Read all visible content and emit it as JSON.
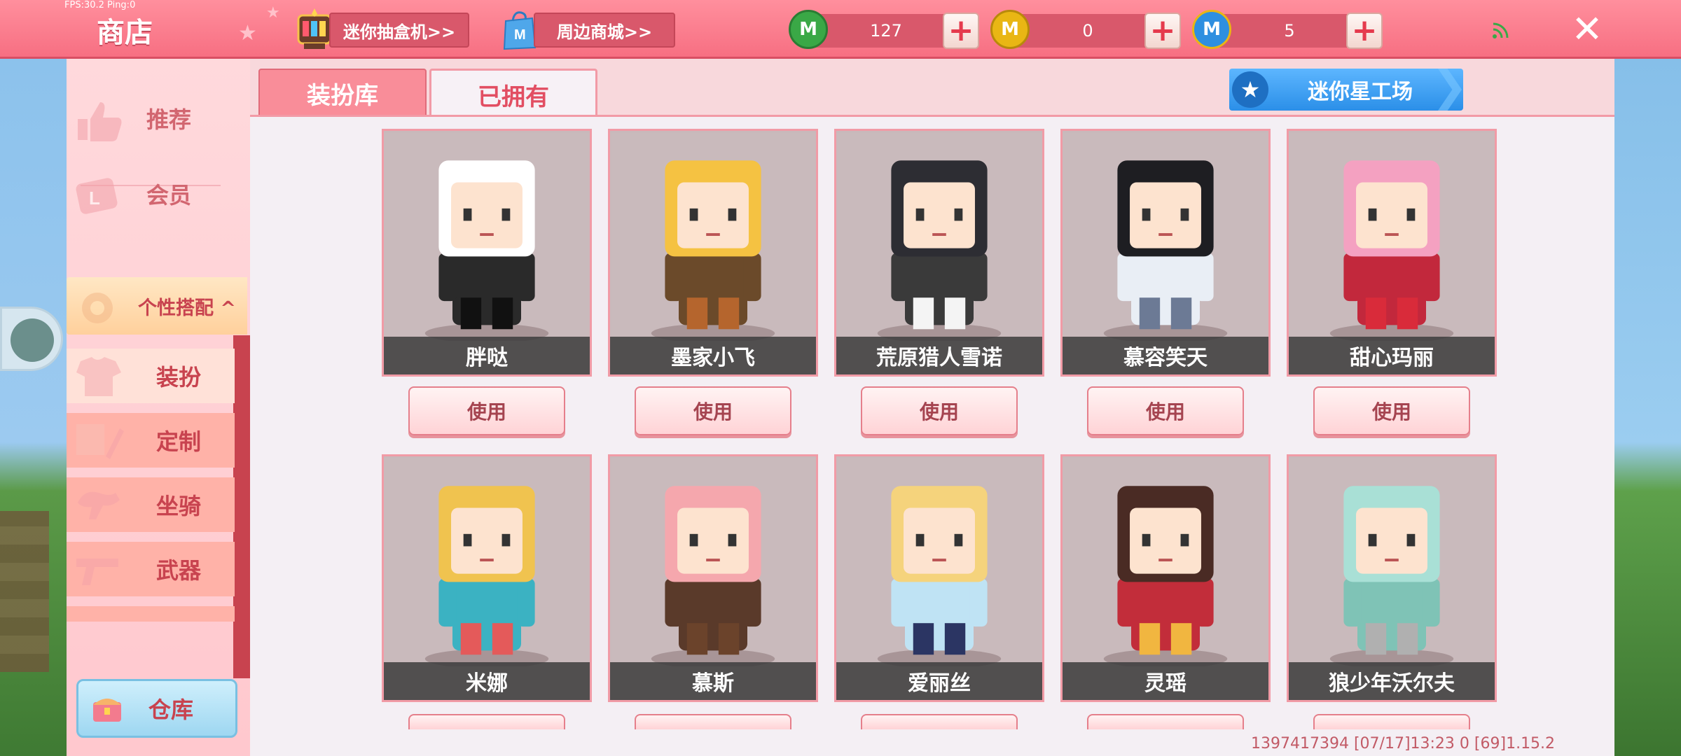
{
  "app": {
    "fps_text": "FPS:30.2  Ping:0",
    "title": "商店"
  },
  "topbar": {
    "gacha_label": "迷你抽盒机>>",
    "mall_label": "周边商城>>",
    "currencies": [
      {
        "icon": "green-coin-icon",
        "value": "127",
        "color": "#3aa846"
      },
      {
        "icon": "gold-coin-icon",
        "value": "0",
        "color": "#e9b614"
      },
      {
        "icon": "blue-coin-icon",
        "value": "5",
        "color": "#2e8fe0"
      }
    ],
    "close_symbol": "✕"
  },
  "sidebar": {
    "items": [
      {
        "label": "推荐",
        "icon": "thumbs-up-icon"
      },
      {
        "label": "会员",
        "icon": "member-card-icon"
      },
      {
        "label": "个性搭配 ^",
        "icon": "style-icon"
      }
    ],
    "subitems": [
      {
        "label": "装扮",
        "icon": "shirt-icon"
      },
      {
        "label": "定制",
        "icon": "brush-icon"
      },
      {
        "label": "坐骑",
        "icon": "mount-icon"
      },
      {
        "label": "武器",
        "icon": "gun-icon"
      }
    ],
    "warehouse_label": "仓库"
  },
  "tabs": {
    "dress_library": "装扮库",
    "owned": "已拥有"
  },
  "star_workshop": "迷你星工场",
  "use_label": "使用",
  "skins": [
    {
      "name": "胖哒",
      "hair": "#ffffff",
      "body": "#2a2a2a",
      "accent": "#111111"
    },
    {
      "name": "墨家小飞",
      "hair": "#f5c242",
      "body": "#6b4a2a",
      "accent": "#b5652d"
    },
    {
      "name": "荒原猎人雪诺",
      "hair": "#2d2d33",
      "body": "#3a3a3a",
      "accent": "#f4f4f4"
    },
    {
      "name": "慕容笑天",
      "hair": "#1e1e22",
      "body": "#e9eef5",
      "accent": "#6c7a95"
    },
    {
      "name": "甜心玛丽",
      "hair": "#f4a1c1",
      "body": "#c2283c",
      "accent": "#d92b3a"
    },
    {
      "name": "米娜",
      "hair": "#f0c34f",
      "body": "#3bb2c2",
      "accent": "#e45a5a"
    },
    {
      "name": "慕斯",
      "hair": "#f5a7ad",
      "body": "#5a3a2a",
      "accent": "#6b432b"
    },
    {
      "name": "爱丽丝",
      "hair": "#f5d37c",
      "body": "#bfe3f4",
      "accent": "#2b3563"
    },
    {
      "name": "灵瑶",
      "hair": "#4a2b24",
      "body": "#c22d3a",
      "accent": "#f1b640"
    },
    {
      "name": "狼少年沃尔夫",
      "hair": "#a9e0d6",
      "body": "#7fc3b6",
      "accent": "#b0b0b0"
    }
  ],
  "footer": "1397417394   [07/17]13:23 0   [69]1.15.2"
}
